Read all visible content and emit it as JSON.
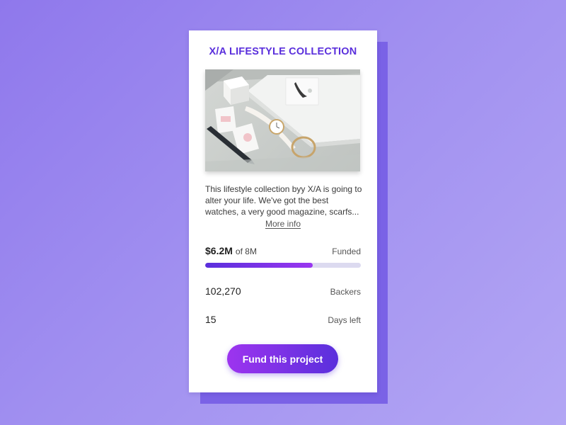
{
  "card": {
    "title": "X/A LIFESTYLE COLLECTION",
    "image": {
      "description_icon": "product-photo",
      "items": [
        "watch",
        "bracelet",
        "magazine",
        "pen",
        "cards",
        "box"
      ]
    },
    "description": "This lifestyle collection byy X/A is going to alter your life. We've got the best watches, a very good magazine, scarfs...",
    "more_info_label": "More info"
  },
  "funding": {
    "amount": "$6.2M",
    "goal": "of 8M",
    "label": "Funded",
    "progress_fraction": 0.69
  },
  "stats": {
    "backers_value": "102,270",
    "backers_label": "Backers",
    "days_value": "15",
    "days_label": "Days left"
  },
  "cta": {
    "label": "Fund this project"
  },
  "colors": {
    "accent": "#5a2fdc",
    "accent_secondary": "#9d34ef",
    "background": "#9a86ef",
    "track": "#dcdaf0"
  }
}
